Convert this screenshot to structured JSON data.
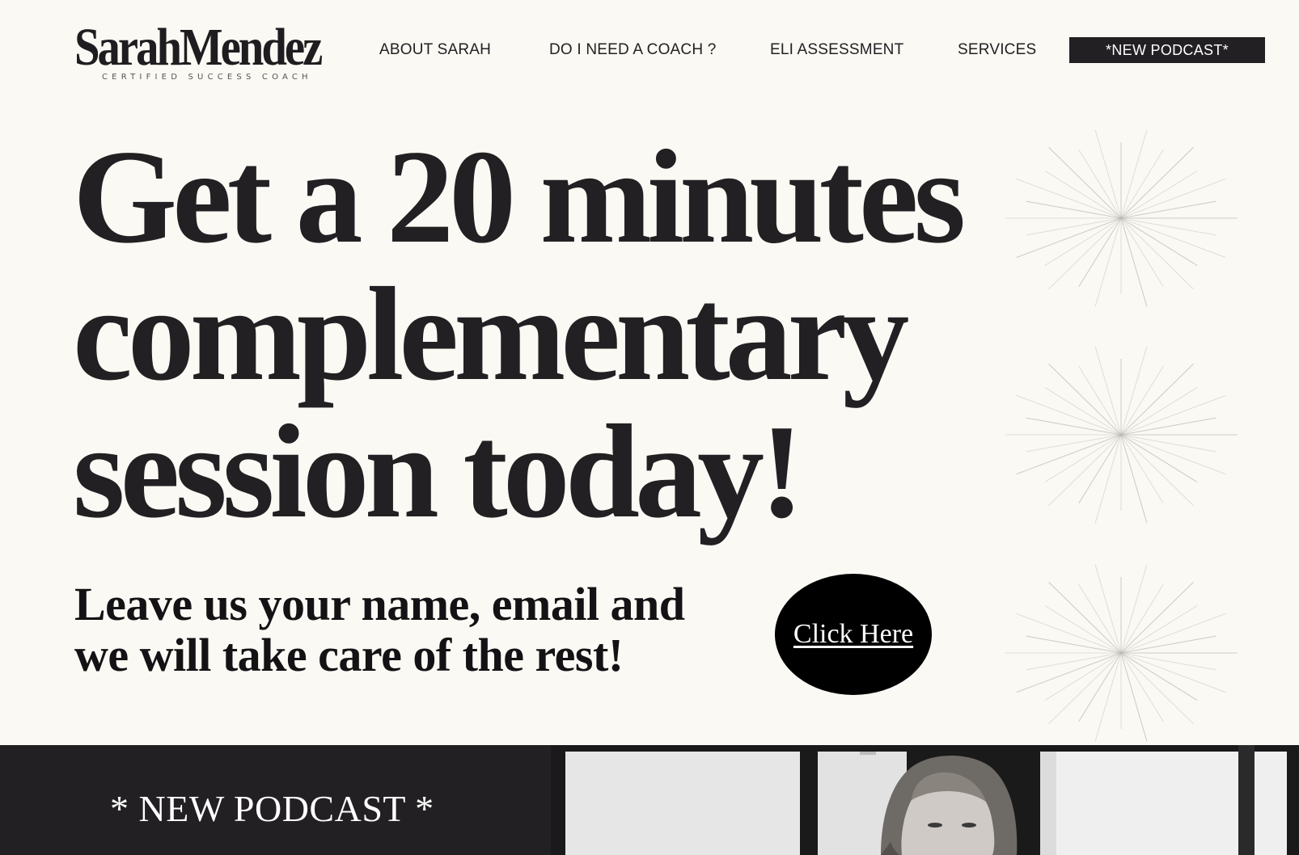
{
  "brand": {
    "name": "SarahMendez",
    "tagline": "CERTIFIED SUCCESS COACH"
  },
  "nav": {
    "items": [
      {
        "label": "ABOUT SARAH"
      },
      {
        "label": "DO I NEED A COACH ?"
      },
      {
        "label": "ELI ASSESSMENT"
      },
      {
        "label": "SERVICES"
      }
    ],
    "podcast_button": "*NEW PODCAST*"
  },
  "hero": {
    "title_lines": [
      "Get a 20 minutes",
      "complementary",
      "session today!"
    ],
    "subtitle_lines": [
      "Leave us your name, email and",
      "we will take care of the rest!"
    ],
    "cta_label": "Click Here"
  },
  "podcast_section": {
    "heading": "* NEW PODCAST *"
  },
  "colors": {
    "background": "#faf9f4",
    "text": "#222022",
    "dark": "#222022",
    "cta": "#000000",
    "starburst": "#bdbab3"
  },
  "icons": {
    "decor": "starburst-icon",
    "photo": "portrait-photo"
  }
}
